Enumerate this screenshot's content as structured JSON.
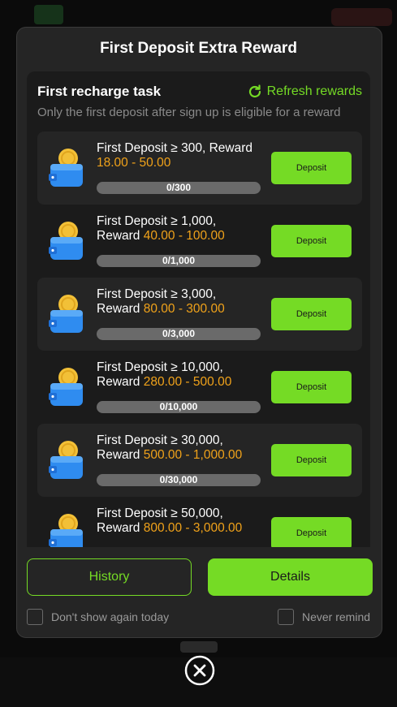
{
  "modal": {
    "title": "First Deposit Extra Reward",
    "panel_title": "First recharge task",
    "refresh_label": "Refresh rewards",
    "subtitle": "Only the first deposit after sign up is eligible for a reward"
  },
  "tasks": [
    {
      "line1": "First Deposit ≥ 300, Reward",
      "line2_prefix": "",
      "reward": "18.00 - 50.00",
      "progress": "0/300",
      "button": "Deposit"
    },
    {
      "line1": "First Deposit ≥ 1,000,",
      "line2_prefix": "Reward ",
      "reward": "40.00 - 100.00",
      "progress": "0/1,000",
      "button": "Deposit"
    },
    {
      "line1": "First Deposit ≥ 3,000,",
      "line2_prefix": "Reward ",
      "reward": "80.00 - 300.00",
      "progress": "0/3,000",
      "button": "Deposit"
    },
    {
      "line1": "First Deposit ≥ 10,000,",
      "line2_prefix": "Reward ",
      "reward": "280.00 - 500.00",
      "progress": "0/10,000",
      "button": "Deposit"
    },
    {
      "line1": "First Deposit ≥ 30,000,",
      "line2_prefix": "Reward ",
      "reward": "500.00 - 1,000.00",
      "progress": "0/30,000",
      "button": "Deposit"
    },
    {
      "line1": "First Deposit ≥ 50,000,",
      "line2_prefix": "Reward ",
      "reward": "800.00 - 3,000.00",
      "progress": "",
      "button": "Deposit"
    }
  ],
  "footer": {
    "history_label": "History",
    "details_label": "Details",
    "dont_show_label": "Don't show again today",
    "never_remind_label": "Never remind"
  },
  "colors": {
    "accent": "#75db25",
    "reward": "#f0a21a",
    "background": "#252525"
  },
  "icons": {
    "refresh": "refresh-icon",
    "wallet": "wallet-coin-icon",
    "close": "close-icon"
  }
}
